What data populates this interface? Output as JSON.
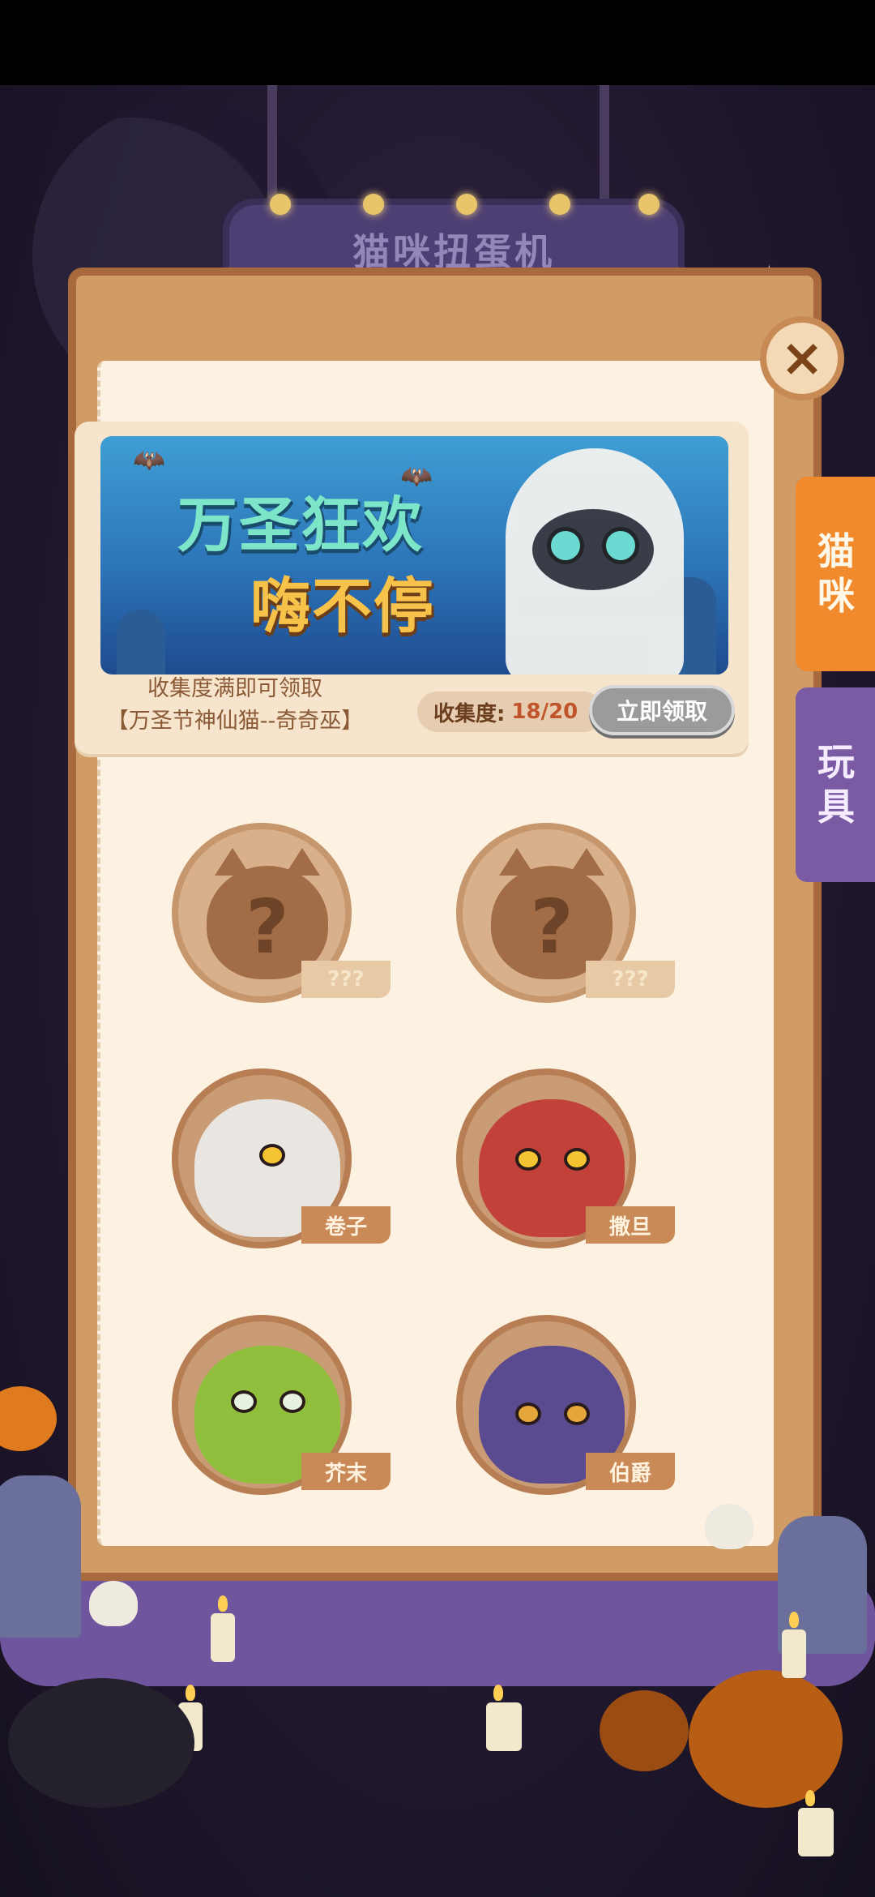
{
  "sign": {
    "title": "猫咪扭蛋机"
  },
  "close": {
    "icon": "×"
  },
  "tabs": [
    {
      "label": "猫\n咪",
      "active": true
    },
    {
      "label": "玩\n具",
      "active": false
    }
  ],
  "banner": {
    "title_line1": "万圣狂欢",
    "title_line2": "嗨不停",
    "tip_line1": "收集度满即可领取",
    "tip_line2": "【万圣节神仙猫--奇奇巫】",
    "progress_label": "收集度:",
    "progress_value": "18/20",
    "claim_label": "立即领取"
  },
  "cats": [
    {
      "name": "???",
      "locked": true
    },
    {
      "name": "???",
      "locked": true
    },
    {
      "name": "卷子",
      "locked": false,
      "color": "#e9e6e2"
    },
    {
      "name": "撒旦",
      "locked": false,
      "color": "#c2413a"
    },
    {
      "name": "芥末",
      "locked": false,
      "color": "#8fbf3c"
    },
    {
      "name": "伯爵",
      "locked": false,
      "color": "#5a4a8f"
    }
  ],
  "colors": {
    "frame": "#d19b66",
    "paper": "#fdf1e2",
    "tab_active": "#f08a2d",
    "tab_inactive": "#7a5aa3"
  }
}
